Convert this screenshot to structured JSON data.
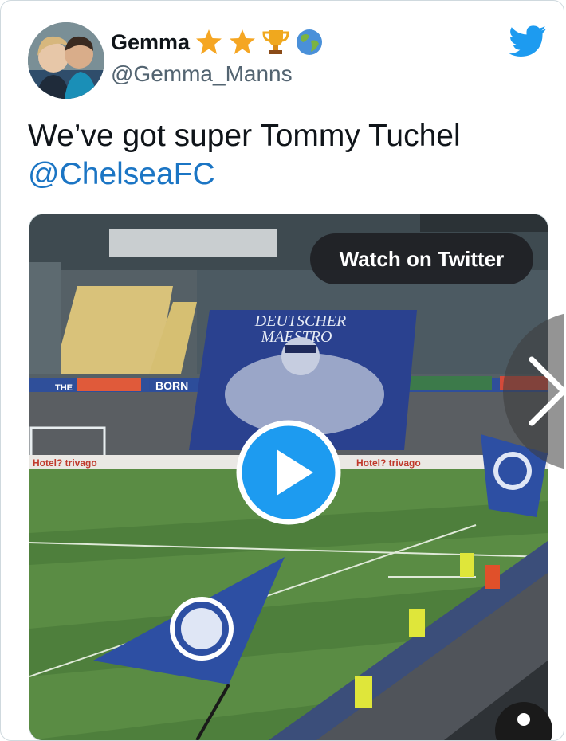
{
  "author": {
    "display_name": "Gemma",
    "handle": "@Gemma_Manns",
    "name_emojis": [
      "star-icon",
      "star-icon",
      "trophy-icon",
      "globe-icon"
    ]
  },
  "tweet": {
    "text_line1": "We’ve got super Tommy Tuchel",
    "mention": "@ChelseaFC"
  },
  "media": {
    "watch_label": "Watch on Twitter",
    "banner_line1": "DEUTSCHER",
    "banner_line2": "MAESTRO",
    "ad_text": "Hotel? trivago",
    "stand_text_1": "THE",
    "stand_text_2": "BORN"
  },
  "colors": {
    "twitter_blue": "#1d9bf0",
    "mention_blue": "#1b75c4",
    "pitch_green": "#4a7a3a",
    "chelsea_blue": "#2d4fa3"
  }
}
